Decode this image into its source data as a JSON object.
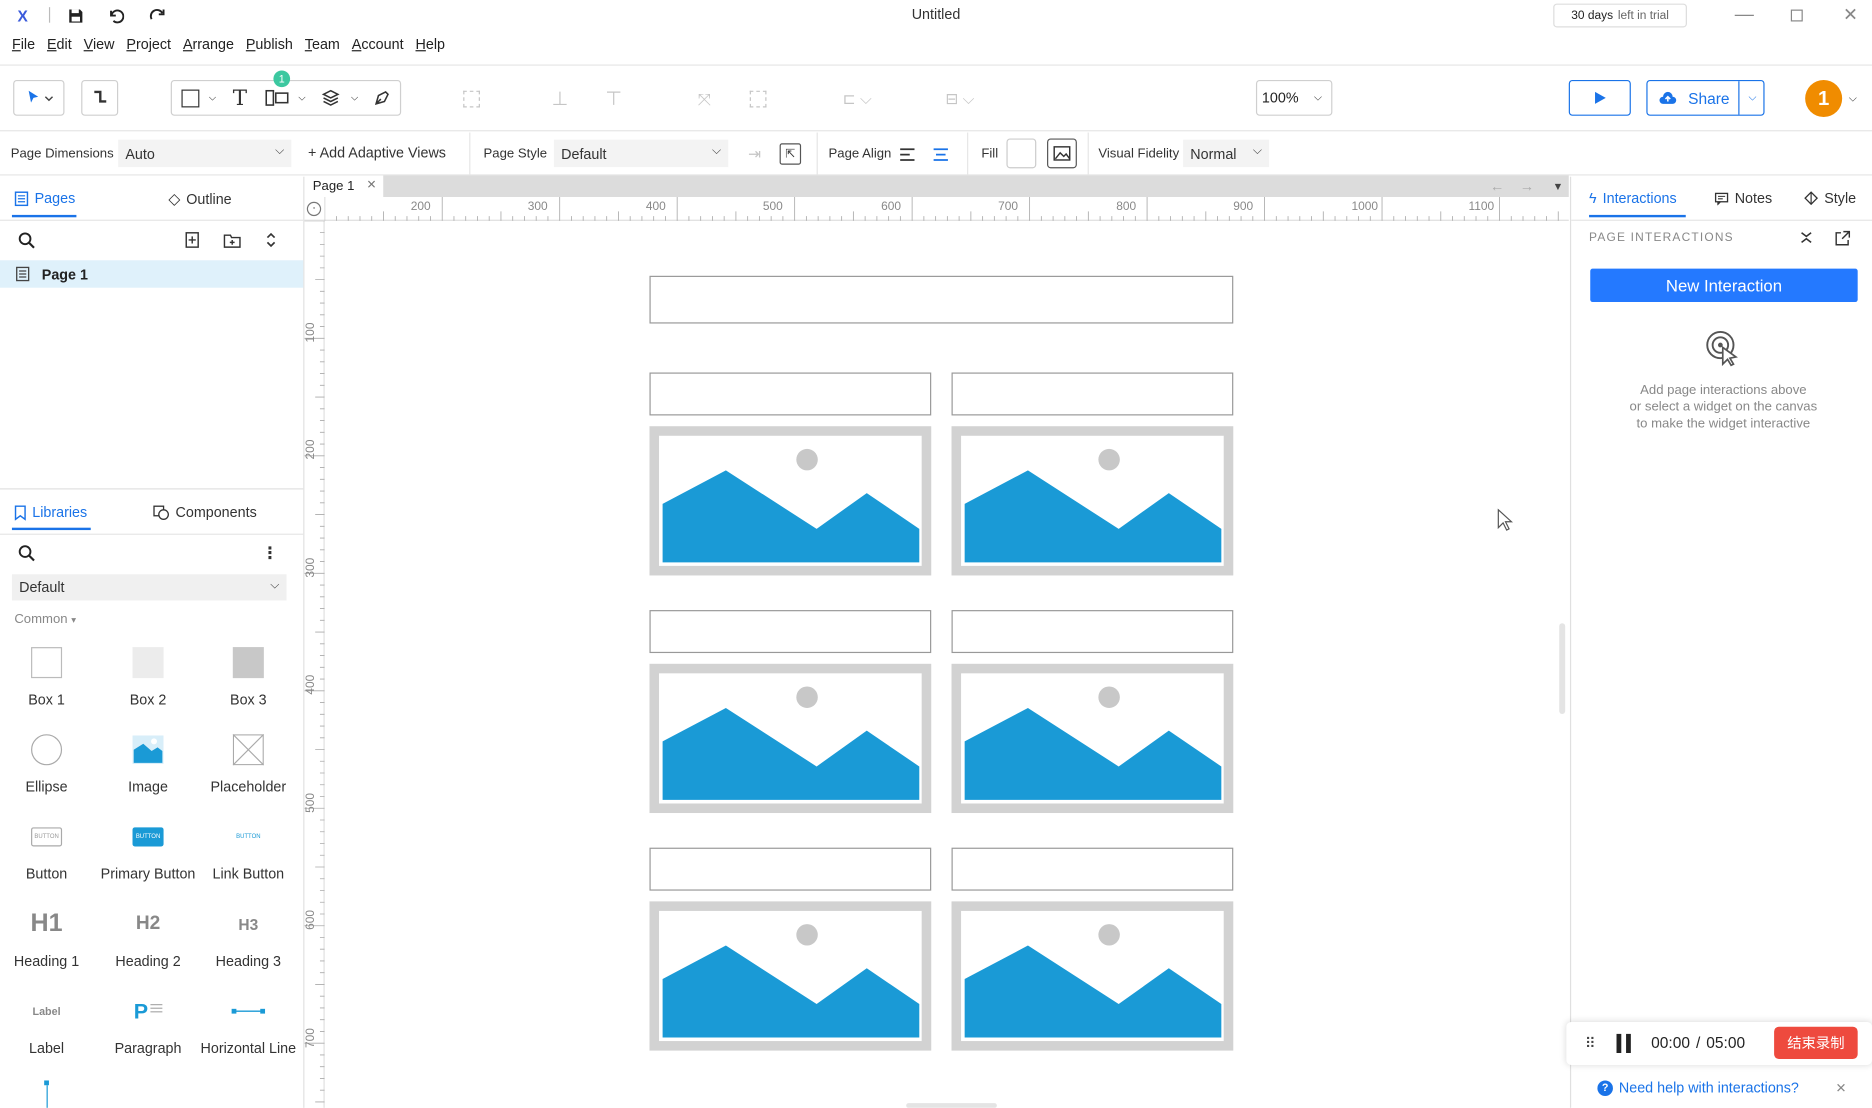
{
  "window": {
    "title": "Untitled",
    "trial_days": "30 days",
    "trial_suffix": "left in trial"
  },
  "menu": [
    "File",
    "Edit",
    "View",
    "Project",
    "Arrange",
    "Publish",
    "Team",
    "Account",
    "Help"
  ],
  "toolbar": {
    "zoom": "100%",
    "share_label": "Share",
    "badge_count": "1",
    "avatar_initial": "1"
  },
  "props": {
    "page_dimensions_label": "Page Dimensions",
    "page_dimensions_value": "Auto",
    "add_adaptive_views": "+ Add Adaptive Views",
    "page_style_label": "Page Style",
    "page_style_value": "Default",
    "page_align_label": "Page Align",
    "fill_label": "Fill",
    "visual_fidelity_label": "Visual Fidelity",
    "visual_fidelity_value": "Normal"
  },
  "left": {
    "tab_pages": "Pages",
    "tab_outline": "Outline",
    "page_item": "Page 1",
    "tab_libraries": "Libraries",
    "tab_components": "Components",
    "library_value": "Default",
    "group_label": "Common",
    "items": [
      "Box 1",
      "Box 2",
      "Box 3",
      "Ellipse",
      "Image",
      "Placeholder",
      "Button",
      "Primary Button",
      "Link Button",
      "Heading 1",
      "Heading 2",
      "Heading 3",
      "Label",
      "Paragraph",
      "Horizontal Line"
    ],
    "button_glyph": "BUTTON",
    "h1_glyph": "H1",
    "h2_glyph": "H2",
    "h3_glyph": "H3",
    "label_glyph": "Label",
    "paragraph_glyph": "P"
  },
  "canvas": {
    "page_tab": "Page 1",
    "ruler_top": [
      "200",
      "300",
      "400",
      "500",
      "600",
      "700",
      "800",
      "900",
      "1000",
      "1100"
    ],
    "ruler_left": [
      "100",
      "200",
      "300",
      "400",
      "500",
      "600",
      "700"
    ]
  },
  "right": {
    "tab_interactions": "Interactions",
    "tab_notes": "Notes",
    "tab_style": "Style",
    "section_title": "PAGE INTERACTIONS",
    "new_interaction": "New Interaction",
    "hint_lines": [
      "Add page interactions above",
      "or select a widget on the canvas",
      "to make the widget interactive"
    ]
  },
  "recording": {
    "elapsed": "00:00",
    "separator": "/",
    "total": "05:00",
    "stop_label": "结束录制"
  },
  "help": {
    "text": "Need help with interactions?"
  },
  "colors": {
    "accent": "#1a73e8",
    "primary_button": "#2479ff",
    "image_blue": "#1a9ad6",
    "avatar": "#f08c00",
    "record_stop": "#ee4a3e"
  }
}
